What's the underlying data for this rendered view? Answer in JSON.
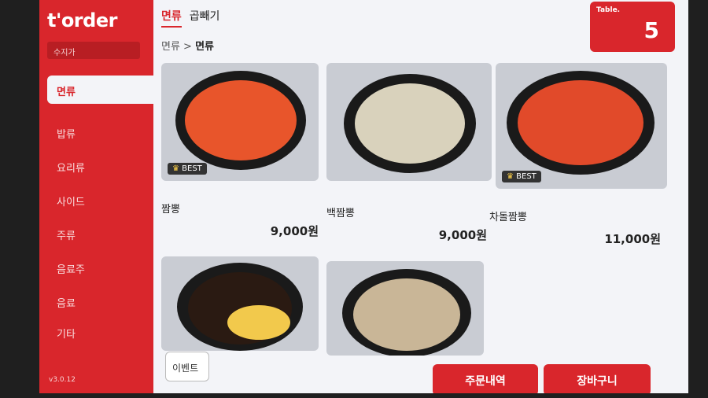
{
  "brand": {
    "name": "t'order",
    "store": "수지가"
  },
  "sidebar": {
    "categories": [
      {
        "label": "면류"
      },
      {
        "label": "밥류"
      },
      {
        "label": "요리류"
      },
      {
        "label": "사이드"
      },
      {
        "label": "주류"
      },
      {
        "label": "음료주"
      },
      {
        "label": "음료"
      },
      {
        "label": "기타"
      }
    ],
    "version": "v3.0.12"
  },
  "tabs": [
    {
      "label": "면류"
    },
    {
      "label": "곱빼기"
    }
  ],
  "breadcrumb": {
    "parent": "면류 >",
    "current": "면류"
  },
  "table": {
    "label": "Table.",
    "number": "5"
  },
  "items": [
    {
      "name": "짬뽕",
      "price": "9,000원",
      "badge": "BEST"
    },
    {
      "name": "백짬뽕",
      "price": "9,000원"
    },
    {
      "name": "차돌짬뽕",
      "price": "11,000원",
      "badge": "BEST"
    },
    {
      "name": "",
      "price": ""
    },
    {
      "name": "",
      "price": ""
    }
  ],
  "buttons": {
    "event": "이벤트",
    "orders": "주문내역",
    "cart": "장바구니"
  },
  "colors": {
    "accent": "#d9262c",
    "background": "#f3f4f8"
  }
}
